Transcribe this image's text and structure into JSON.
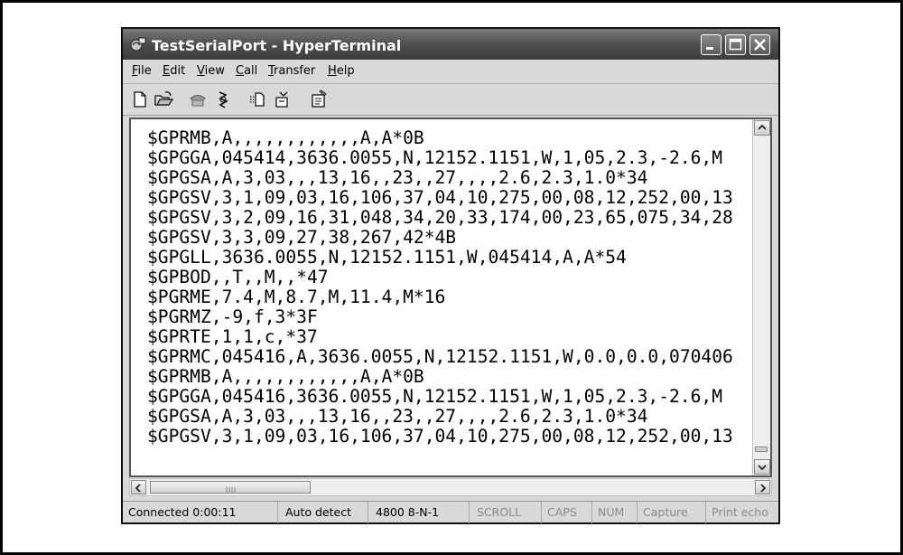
{
  "window": {
    "title": "TestSerialPort - HyperTerminal"
  },
  "menu": [
    "File",
    "Edit",
    "View",
    "Call",
    "Transfer",
    "Help"
  ],
  "toolbar": {
    "icons": [
      "new-document-icon",
      "open-folder-icon",
      "phone-dial-icon",
      "disconnect-icon",
      "send-file-icon",
      "receive-file-icon",
      "properties-icon"
    ]
  },
  "terminal": {
    "lines": [
      "$GPRMB,A,,,,,,,,,,,,A,A*0B",
      "$GPGGA,045414,3636.0055,N,12152.1151,W,1,05,2.3,-2.6,M",
      "$GPGSA,A,3,03,,,13,16,,23,,27,,,,2.6,2.3,1.0*34",
      "$GPGSV,3,1,09,03,16,106,37,04,10,275,00,08,12,252,00,13",
      "$GPGSV,3,2,09,16,31,048,34,20,33,174,00,23,65,075,34,28",
      "$GPGSV,3,3,09,27,38,267,42*4B",
      "$GPGLL,3636.0055,N,12152.1151,W,045414,A,A*54",
      "$GPBOD,,T,,M,,*47",
      "$PGRME,7.4,M,8.7,M,11.4,M*16",
      "$PGRMZ,-9,f,3*3F",
      "$GPRTE,1,1,c,*37",
      "$GPRMC,045416,A,3636.0055,N,12152.1151,W,0.0,0.0,070406",
      "$GPRMB,A,,,,,,,,,,,,A,A*0B",
      "$GPGGA,045416,3636.0055,N,12152.1151,W,1,05,2.3,-2.6,M",
      "$GPGSA,A,3,03,,,13,16,,23,,27,,,,2.6,2.3,1.0*34",
      "$GPGSV,3,1,09,03,16,106,37,04,10,275,00,08,12,252,00,13"
    ]
  },
  "status": {
    "connected": "Connected 0:00:11",
    "detect": "Auto detect",
    "settings": "4800 8-N-1",
    "scroll": "SCROLL",
    "caps": "CAPS",
    "num": "NUM",
    "capture": "Capture",
    "print_echo": "Print echo"
  }
}
